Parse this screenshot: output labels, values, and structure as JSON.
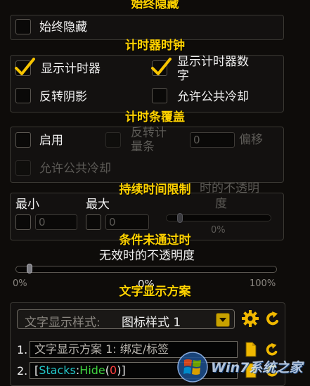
{
  "sections": {
    "always_hide": "始终隐藏",
    "timer_clock": "计时器时钟",
    "timer_bar_cover": "计时条覆盖",
    "duration_limit": "持续时间限制",
    "condition_failed": "条件未通过时",
    "text_scheme": "文字显示方案"
  },
  "always_hide": {
    "checkbox_label": "始终隐藏",
    "checked": false
  },
  "timer_clock": {
    "show_timer": {
      "label": "显示计时器",
      "checked": true
    },
    "show_timer_numbers": {
      "label_line1": "显示计时器数",
      "label_line2": "字",
      "checked": true
    },
    "reverse_shadow": {
      "label": "反转阴影",
      "checked": false
    },
    "allow_global_cd": {
      "label": "允许公共冷却",
      "checked": false
    }
  },
  "timer_bar_cover": {
    "enable": {
      "label": "启用",
      "checked": false
    },
    "reverse_timer_bar": {
      "label_line1": "反转计",
      "label_line2": "量条",
      "checked": false
    },
    "offset_value": "0",
    "offset_label": "偏移",
    "allow_global_cd": {
      "label": "允许公共冷却",
      "checked": false
    }
  },
  "duration_limit": {
    "min_label": "最小",
    "max_label": "最大",
    "min_value": "0",
    "max_value": "0",
    "opacity_label_line1": "时的不透明",
    "opacity_label_line2": "度",
    "opacity_value": "0%"
  },
  "condition_failed": {
    "opacity_label": "无效时的不透明度",
    "slider_value": 0,
    "min_label": "0%",
    "max_label": "100%",
    "value_label": "0%"
  },
  "text_scheme": {
    "dropdown_label": "文字显示样式:",
    "dropdown_value": "图标样式 1",
    "rows": [
      {
        "index": "1.",
        "text": "文字显示方案 1: 绑定/标签"
      },
      {
        "index": "2.",
        "open_bracket": "[",
        "part1": "Stacks",
        "colon": ":",
        "part2": "Hide",
        "paren_open": "(",
        "num": "0",
        "paren_close": ")",
        "close_bracket": "]"
      }
    ]
  },
  "watermark": {
    "brand_text": "Win7系统之家"
  },
  "colors": {
    "title_gold": "#ffd200",
    "check_gold": "#f7c400",
    "stacks_cyan": "#23c6c8",
    "hide_green": "#3fd23f",
    "num_red": "#ff4040"
  }
}
